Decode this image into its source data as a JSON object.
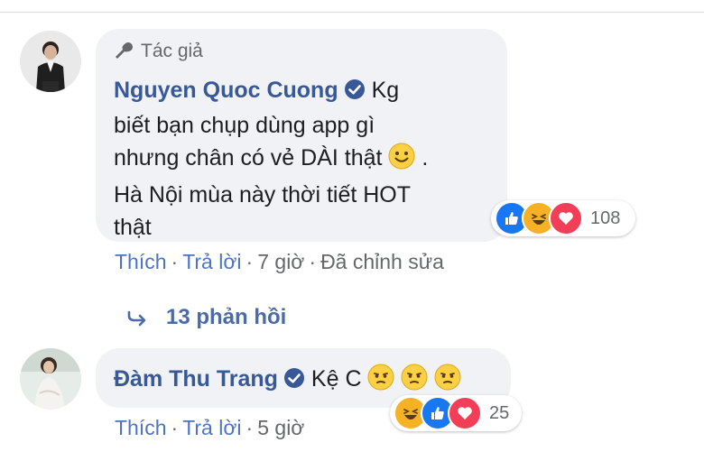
{
  "comment1": {
    "author_badge": "Tác giả",
    "author": "Nguyen Quoc Cuong",
    "text_line1": "Kg",
    "text_line2": "biết bạn chụp dùng app gì",
    "text_line3a": "nhưng chân có vẻ DÀI thật",
    "text_line3b": ".",
    "text_line4": "Hà Nội mùa này thời tiết HOT",
    "text_line5": "thật",
    "reaction_count": "108",
    "reactions": [
      "like-icon",
      "haha-icon",
      "love-icon"
    ],
    "actions": {
      "like": "Thích",
      "reply": "Trả lời",
      "time": "7 giờ",
      "edited": "Đã chỉnh sửa"
    },
    "replies_label": "13 phản hồi"
  },
  "comment2": {
    "author": "Đàm Thu Trang",
    "text": "Kệ C",
    "emojis": [
      "disappointed-emoji",
      "disappointed-emoji",
      "disappointed-emoji"
    ],
    "reaction_count": "25",
    "reactions": [
      "haha-icon",
      "like-icon",
      "love-icon"
    ],
    "actions": {
      "like": "Thích",
      "reply": "Trả lời",
      "time": "5 giờ"
    }
  },
  "colors": {
    "link": "#385898",
    "bubble": "#f0f2f5",
    "like": "#1877f2",
    "love": "#f33e58",
    "haha": "#f7b125"
  }
}
